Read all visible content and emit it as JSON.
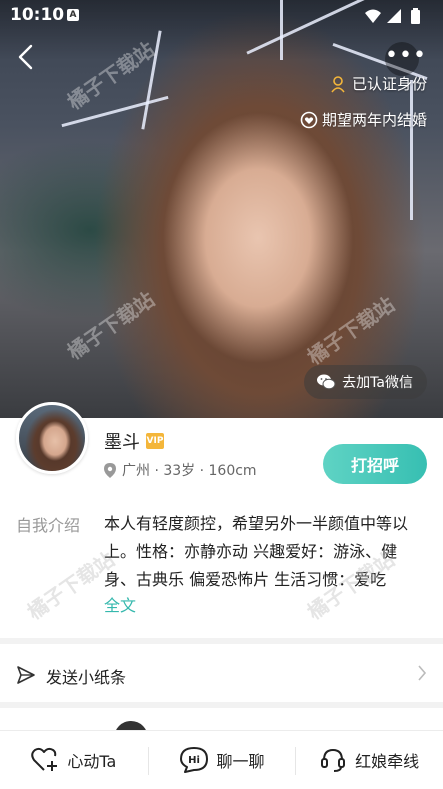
{
  "status_bar": {
    "time": "10:10",
    "notification_letter": "A"
  },
  "hero": {
    "verified_label": "已认证身份",
    "marry_label": "期望两年内结婚",
    "wechat_button": "去加Ta微信",
    "more_label": "•••"
  },
  "watermark": "橘子下载站",
  "profile": {
    "name": "墨斗",
    "vip_label": "VIP",
    "meta": "广州 · 33岁 · 160cm",
    "greet_button": "打招呼",
    "intro_label": "自我介绍",
    "intro_text": "本人有轻度颜控，希望另外一半颜值中等以上。性格：亦静亦动 兴趣爱好：游泳、健身、古典乐 偏爱恐怖片 生活习惯：爱吃",
    "intro_more": "全文"
  },
  "note_row": {
    "label": "发送小纸条"
  },
  "bottom_bar": [
    {
      "label": "心动Ta",
      "icon": "heart-plus-icon"
    },
    {
      "label": "聊一聊",
      "icon": "chat-hi-icon"
    },
    {
      "label": "红娘牵线",
      "icon": "headset-icon"
    }
  ],
  "colors": {
    "accent": "#37bfb2",
    "vip": "#f4b63a"
  }
}
